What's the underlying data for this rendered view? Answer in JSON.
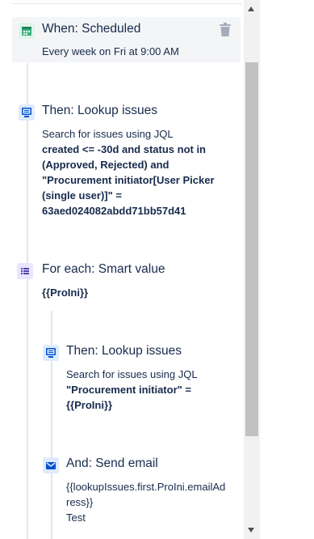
{
  "trigger": {
    "title": "When: Scheduled",
    "description": "Every week on Fri at 9:00 AM",
    "icon": "calendar-icon",
    "delete_icon": "trash-icon"
  },
  "step1": {
    "title": "Then: Lookup issues",
    "intro": "Search for issues using JQL",
    "jql_line1": "created <= -30d and status not in",
    "jql_line2": "(Approved, Rejected) and",
    "jql_line3": "\"Procurement initiator[User Picker",
    "jql_line4": "(single user)]\" =",
    "jql_line5": "63aed024082abdd71bb57d41",
    "icon": "monitor-icon"
  },
  "branch": {
    "title": "For each: Smart value",
    "value": "{{ProIni}}",
    "icon": "list-icon"
  },
  "step2": {
    "title": "Then: Lookup issues",
    "intro": "Search for issues using JQL",
    "jql_line1": "\"Procurement initiator\" =",
    "jql_line2": "{{ProIni}}",
    "icon": "monitor-icon"
  },
  "step3": {
    "title": "And: Send email",
    "to_line1": "{{lookupIssues.first.ProIni.emailAd",
    "to_line2": "ress}}",
    "subject": "Test",
    "icon": "envelope-icon"
  },
  "colors": {
    "trigger_icon": "#36b37e",
    "action_icon": "#0052cc",
    "branch_icon": "#5243aa",
    "scroll_thumb": "#c1c1c1"
  }
}
